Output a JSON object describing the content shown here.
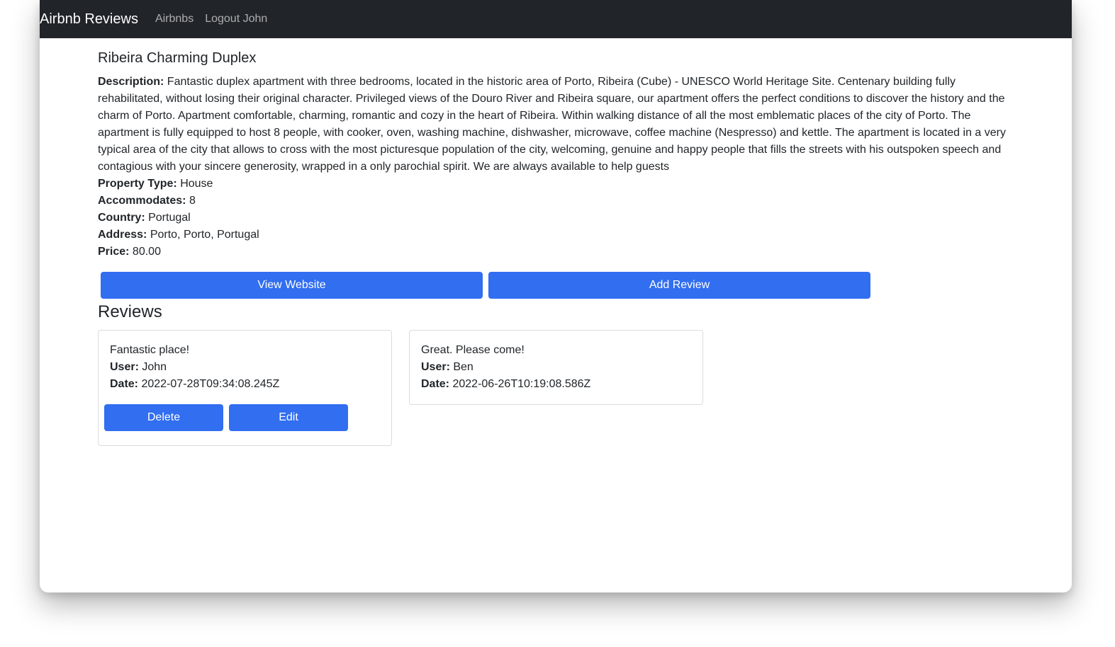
{
  "navbar": {
    "brand": "Airbnb Reviews",
    "links": [
      "Airbnbs",
      "Logout John"
    ]
  },
  "listing": {
    "title": "Ribeira Charming Duplex",
    "description_label": "Description:",
    "description": "Fantastic duplex apartment with three bedrooms, located in the historic area of Porto, Ribeira (Cube) - UNESCO World Heritage Site. Centenary building fully rehabilitated, without losing their original character. Privileged views of the Douro River and Ribeira square, our apartment offers the perfect conditions to discover the history and the charm of Porto. Apartment comfortable, charming, romantic and cozy in the heart of Ribeira. Within walking distance of all the most emblematic places of the city of Porto. The apartment is fully equipped to host 8 people, with cooker, oven, washing machine, dishwasher, microwave, coffee machine (Nespresso) and kettle. The apartment is located in a very typical area of the city that allows to cross with the most picturesque population of the city, welcoming, genuine and happy people that fills the streets with his outspoken speech and contagious with your sincere generosity, wrapped in a only parochial spirit. We are always available to help guests",
    "fields": [
      {
        "label": "Property Type:",
        "value": "House"
      },
      {
        "label": "Accommodates:",
        "value": "8"
      },
      {
        "label": "Country:",
        "value": "Portugal"
      },
      {
        "label": "Address:",
        "value": "Porto, Porto, Portugal"
      },
      {
        "label": "Price:",
        "value": "80.00"
      }
    ],
    "view_website_label": "View Website",
    "add_review_label": "Add Review"
  },
  "reviews": {
    "heading": "Reviews",
    "user_label": "User:",
    "date_label": "Date:",
    "delete_label": "Delete",
    "edit_label": "Edit",
    "items": [
      {
        "text": "Fantastic place!",
        "user": "John",
        "date": "2022-07-28T09:34:08.245Z"
      },
      {
        "text": "Great. Please come!",
        "user": "Ben",
        "date": "2022-06-26T10:19:08.586Z"
      }
    ]
  },
  "colors": {
    "navbar_bg": "#212529",
    "primary": "#316ef0"
  }
}
